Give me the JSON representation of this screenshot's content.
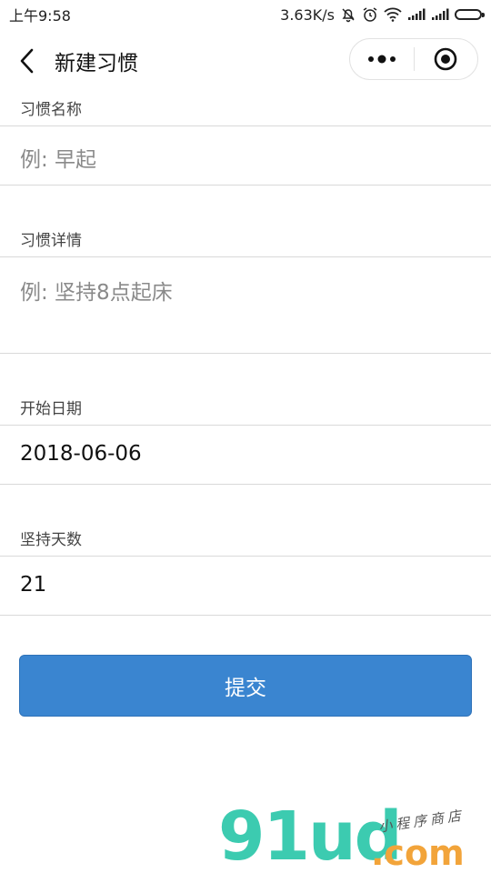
{
  "status_bar": {
    "time": "上午9:58",
    "network_speed": "3.63K/s",
    "icons": [
      "mute-bell-icon",
      "alarm-icon",
      "wifi-icon",
      "signal-icon",
      "signal-icon",
      "battery-icon"
    ]
  },
  "nav": {
    "title": "新建习惯",
    "back_icon": "chevron-left-icon",
    "more_icon": "more-dots-icon",
    "close_icon": "target-circle-icon"
  },
  "form": {
    "habit_name": {
      "label": "习惯名称",
      "placeholder": "例: 早起",
      "value": ""
    },
    "habit_detail": {
      "label": "习惯详情",
      "placeholder": "例: 坚持8点起床",
      "value": ""
    },
    "start_date": {
      "label": "开始日期",
      "value": "2018-06-06"
    },
    "days": {
      "label": "坚持天数",
      "value": "21"
    },
    "submit_label": "提交"
  },
  "watermark": {
    "main": "91ud",
    "suffix": ".com",
    "tagline": "小程序商店"
  },
  "colors": {
    "primary": "#3a85d0",
    "divider": "#d9d9d9",
    "placeholder": "#8a8a8a",
    "watermark_green": "#3ccbb0",
    "watermark_orange": "#f2a43a"
  }
}
